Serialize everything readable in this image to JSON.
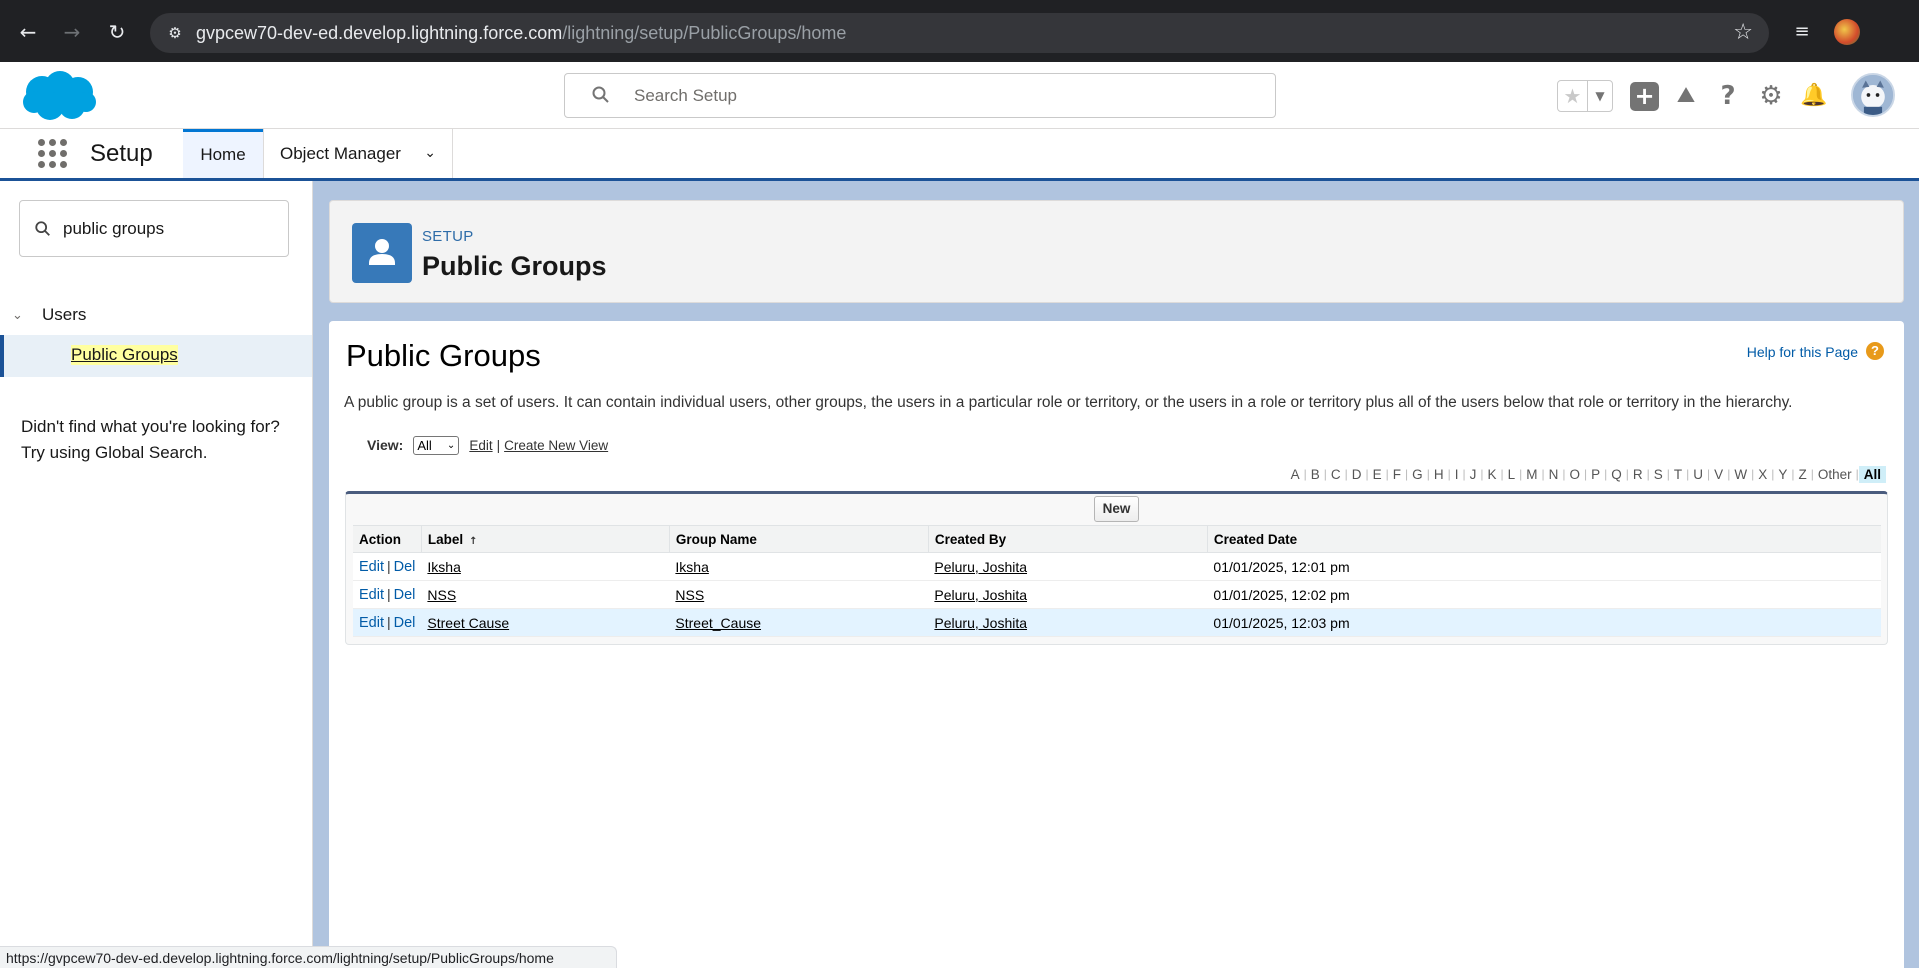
{
  "browser": {
    "url_host": "gvpcew70-dev-ed.develop.lightning.force.com",
    "url_path": "/lightning/setup/PublicGroups/home",
    "status_url": "https://gvpcew70-dev-ed.develop.lightning.force.com/lightning/setup/PublicGroups/home",
    "icons": [
      "back-arrow-icon",
      "forward-arrow-icon",
      "reload-icon",
      "site-info-icon",
      "bookmark-star-icon",
      "media-control-icon",
      "profile-icon"
    ]
  },
  "header": {
    "search_placeholder": "Search Setup",
    "icons": [
      "salesforce-cloud-logo",
      "favorites-star-icon",
      "global-actions-add-icon",
      "trailhead-icon",
      "help-icon",
      "setup-gear-icon",
      "notifications-bell-icon",
      "user-avatar"
    ]
  },
  "context_bar": {
    "app_name": "Setup",
    "tabs": [
      {
        "label": "Home",
        "selected": true
      },
      {
        "label": "Object Manager",
        "selected": false
      }
    ]
  },
  "left_panel": {
    "quick_find_value": "public groups",
    "tree_parent": "Users",
    "tree_item": "Public Groups",
    "not_found_line1": "Didn't find what you're looking for?",
    "not_found_line2": "Try using Global Search."
  },
  "page_header": {
    "eyebrow": "SETUP",
    "title": "Public Groups"
  },
  "content": {
    "title": "Public Groups",
    "help_link": "Help for this Page",
    "description": "A public group is a set of users. It can contain individual users, other groups, the users in a particular role or territory, or the users in a role or territory plus all of the users below that role or territory in the hierarchy.",
    "view_label": "View:",
    "view_selected": "All",
    "edit_link": "Edit",
    "create_view_link": "Create New View",
    "alpha": [
      "A",
      "B",
      "C",
      "D",
      "E",
      "F",
      "G",
      "H",
      "I",
      "J",
      "K",
      "L",
      "M",
      "N",
      "O",
      "P",
      "Q",
      "R",
      "S",
      "T",
      "U",
      "V",
      "W",
      "X",
      "Y",
      "Z",
      "Other",
      "All"
    ],
    "alpha_selected": "All",
    "new_button": "New",
    "columns": [
      "Action",
      "Label",
      "Group Name",
      "Created By",
      "Created Date"
    ],
    "action_edit": "Edit",
    "action_del": "Del",
    "rows": [
      {
        "label": "Iksha",
        "group_name": "Iksha",
        "created_by": "Peluru, Joshita",
        "created_date": "01/01/2025, 12:01 pm"
      },
      {
        "label": "NSS",
        "group_name": "NSS",
        "created_by": "Peluru, Joshita",
        "created_date": "01/01/2025, 12:02 pm"
      },
      {
        "label": "Street Cause",
        "group_name": "Street_Cause",
        "created_by": "Peluru, Joshita",
        "created_date": "01/01/2025, 12:03 pm"
      }
    ],
    "highlighted_row": 2,
    "colors": {
      "brand_blue": "#0176d3",
      "page_bg": "#b0c4df",
      "header_icon": "#3779b9"
    }
  }
}
